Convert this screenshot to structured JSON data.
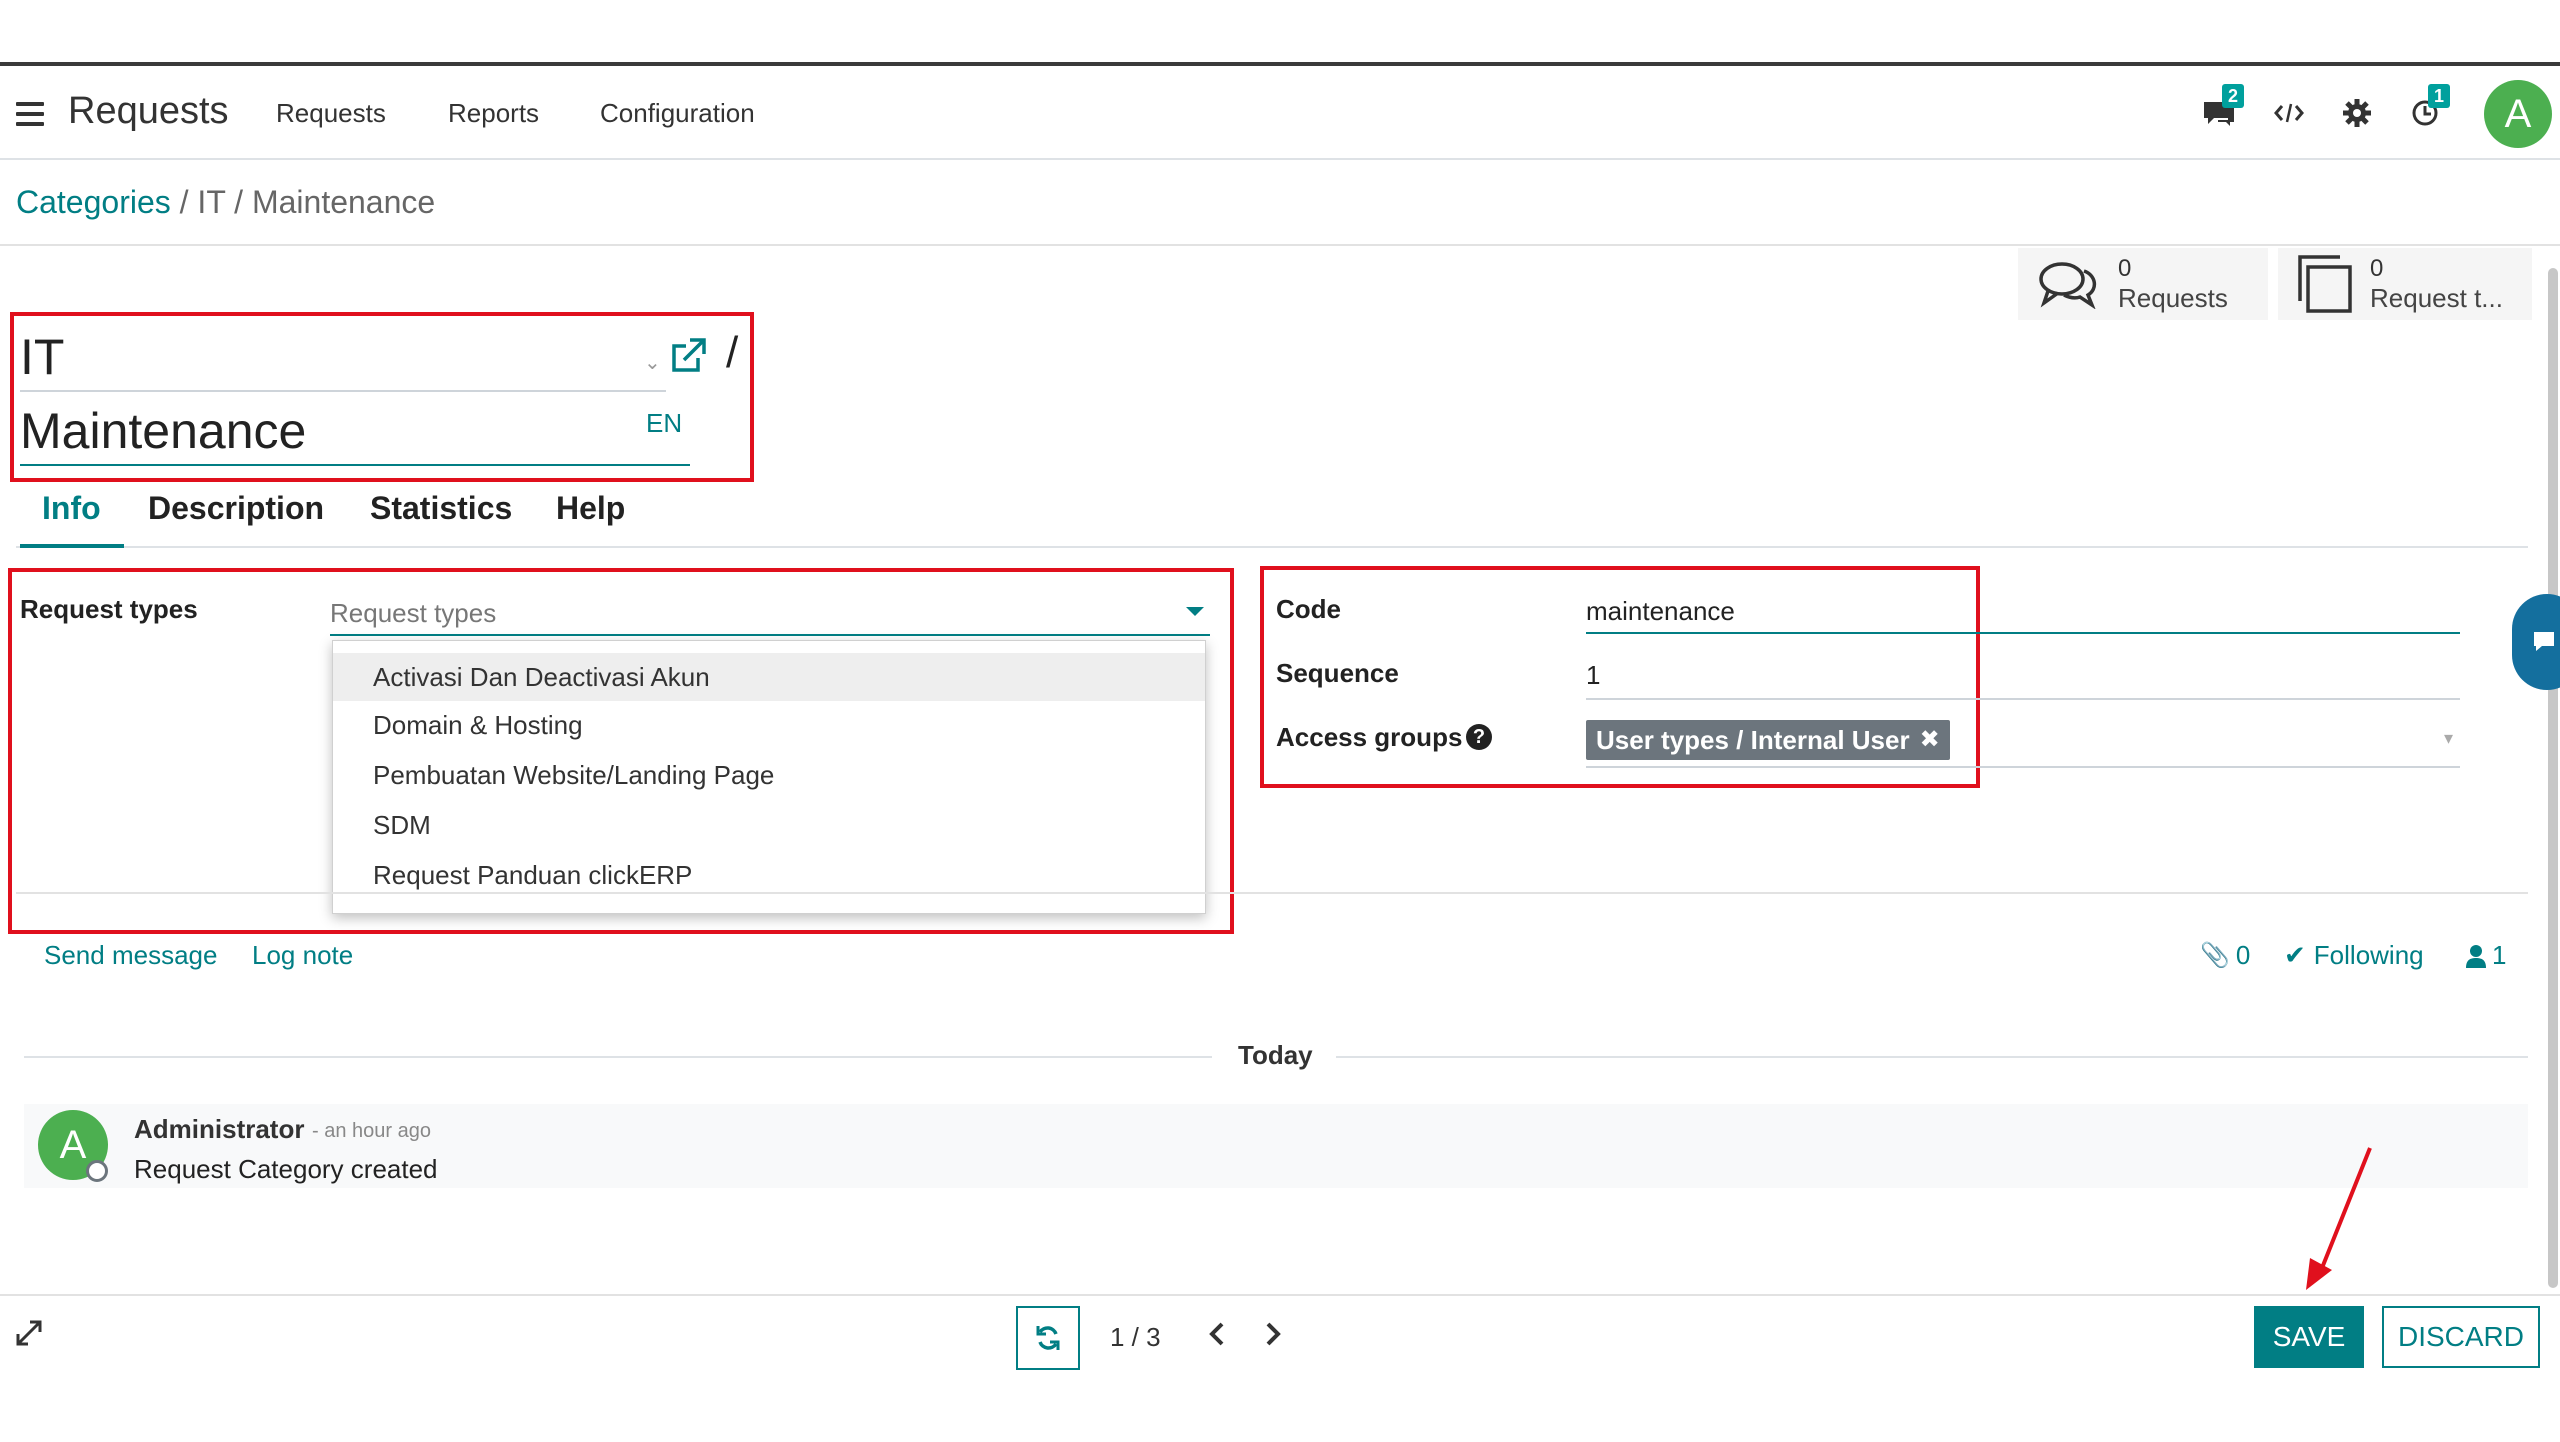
{
  "app": {
    "title": "Requests",
    "menu": [
      "Requests",
      "Reports",
      "Configuration"
    ],
    "chat_badge": "2",
    "activity_badge": "1",
    "user_initial": "A"
  },
  "breadcrumb": {
    "root": "Categories",
    "rest": "/ IT / Maintenance"
  },
  "stats": [
    {
      "value": "0",
      "label": "Requests"
    },
    {
      "value": "0",
      "label": "Request t..."
    }
  ],
  "record": {
    "parent": "IT",
    "slash": "/",
    "name": "Maintenance",
    "lang": "EN"
  },
  "tabs": [
    "Info",
    "Description",
    "Statistics",
    "Help"
  ],
  "fields": {
    "request_types_label": "Request types",
    "request_types_placeholder": "Request types",
    "request_type_options": [
      "Activasi Dan Deactivasi Akun",
      "Domain & Hosting",
      "Pembuatan Website/Landing Page",
      "SDM",
      "Request Panduan clickERP"
    ],
    "code_label": "Code",
    "code_value": "maintenance",
    "sequence_label": "Sequence",
    "sequence_value": "1",
    "access_groups_label": "Access groups",
    "access_group_tag": "User types / Internal User"
  },
  "chatter": {
    "send_message": "Send message",
    "log_note": "Log note",
    "attachments": "0",
    "following": "Following",
    "followers": "1",
    "day": "Today",
    "author": "Administrator",
    "time": "- an hour ago",
    "message": "Request Category created",
    "author_initial": "A"
  },
  "pager": {
    "value": "1 / 3"
  },
  "actions": {
    "save": "SAVE",
    "discard": "DISCARD"
  },
  "colors": {
    "accent": "#017e84",
    "highlight_box": "#e0101d",
    "avatar": "#4caf50",
    "tag": "#6c757d"
  }
}
